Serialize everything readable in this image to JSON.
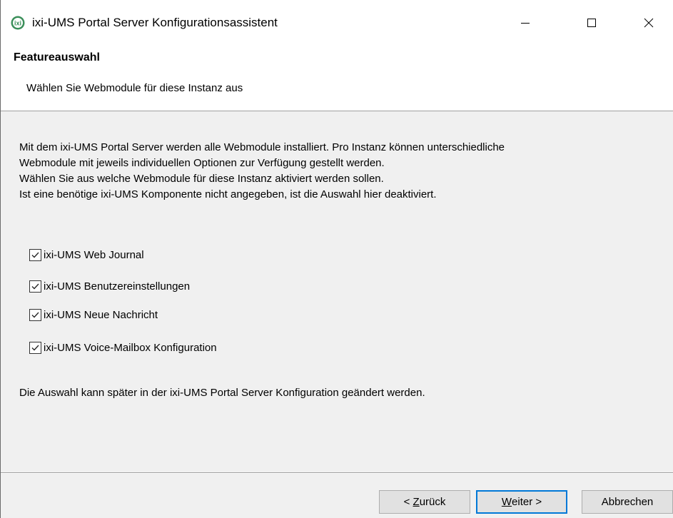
{
  "window": {
    "title": "ixi-UMS Portal Server Konfigurationsassistent",
    "icon": "ixi-app-icon",
    "controls": [
      "minimize-icon",
      "maximize-icon",
      "close-icon"
    ]
  },
  "header": {
    "title": "Featureauswahl",
    "subtitle": "Wählen Sie Webmodule für diese Instanz aus"
  },
  "description": {
    "lines": [
      "Mit dem ixi-UMS Portal Server werden alle Webmodule installiert. Pro Instanz können unterschiedliche",
      "Webmodule mit jeweils individuellen Optionen zur Verfügung gestellt werden.",
      "Wählen Sie aus welche Webmodule für diese Instanz aktiviert werden sollen.",
      "Ist eine benötige ixi-UMS Komponente nicht angegeben, ist die Auswahl hier deaktiviert."
    ]
  },
  "modules": [
    {
      "label": "ixi-UMS Web Journal",
      "checked": true
    },
    {
      "label": "ixi-UMS Benutzereinstellungen",
      "checked": true
    },
    {
      "label": "ixi-UMS Neue Nachricht",
      "checked": true
    },
    {
      "label": "ixi-UMS Voice-Mailbox Konfiguration",
      "checked": true
    }
  ],
  "footnote": "Die Auswahl kann später in der ixi-UMS Portal Server Konfiguration geändert werden.",
  "buttons": {
    "back": {
      "mnemonic": "Z",
      "rest": "urück",
      "prefix": "< "
    },
    "next": {
      "mnemonic": "W",
      "rest": "eiter >"
    },
    "cancel": {
      "mnemonic": "",
      "rest": "Abbrechen"
    }
  },
  "colors": {
    "accent": "#0078d7",
    "dialog_bg": "#f0f0f0",
    "icon_green": "#3b8f5a"
  }
}
